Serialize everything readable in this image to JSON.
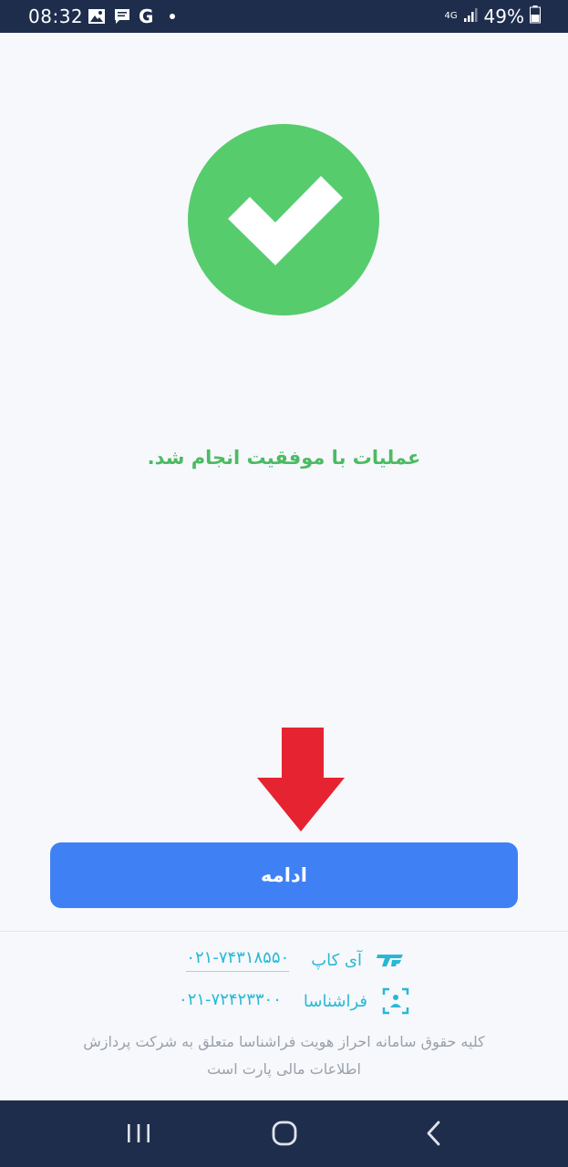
{
  "status_bar": {
    "time": "08:32",
    "network": "4G",
    "battery": "49%"
  },
  "success": {
    "icon": "check-icon",
    "color": "#56cc6d",
    "message": "عملیات با موفقیت انجام شد."
  },
  "continue_button": {
    "label": "ادامه",
    "color": "#3f81f5"
  },
  "contacts": [
    {
      "brand": "آی کاپ",
      "phone": "۰۲۱-۷۴۳۱۸۵۵۰",
      "icon": "icop-logo-icon"
    },
    {
      "brand": "فراشناسا",
      "phone": "۰۲۱-۷۲۴۲۳۳۰۰",
      "icon": "farashenasa-logo-icon"
    }
  ],
  "copyright": {
    "line1": "کلیه حقوق سامانه احراز هویت فراشناسا متعلق به شرکت پردازش",
    "line2": "اطلاعات مالی پارت است"
  },
  "accent_color": "#28b8d6",
  "nav_bar": {
    "buttons": [
      "recent-apps-icon",
      "home-icon",
      "back-icon"
    ]
  }
}
